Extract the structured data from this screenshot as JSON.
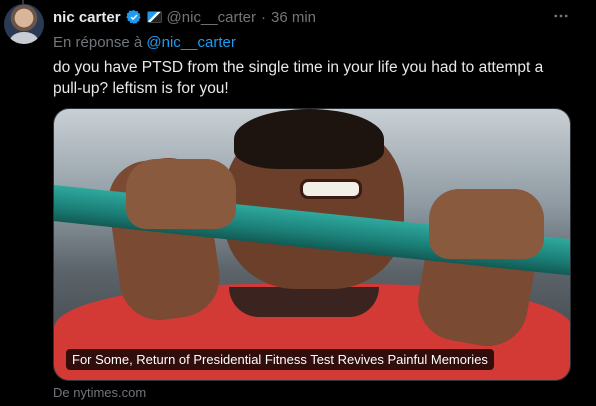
{
  "tweet": {
    "author_name": "nic carter",
    "author_handle": "@nic__carter",
    "separator": "·",
    "timestamp": "36 min",
    "reply_prefix": "En réponse à",
    "reply_handle": "@nic__carter",
    "text": "do you have PTSD from the single time in your life you had to attempt a pull-up? leftism is for you!",
    "more_icon": "more-horizontal-icon"
  },
  "card": {
    "caption": "For Some, Return of Presidential Fitness Test Revives Painful Memories",
    "source": "De nytimes.com"
  },
  "colors": {
    "background": "#000000",
    "text": "#e7e9ea",
    "muted": "#71767b",
    "link": "#1d9bf0"
  }
}
